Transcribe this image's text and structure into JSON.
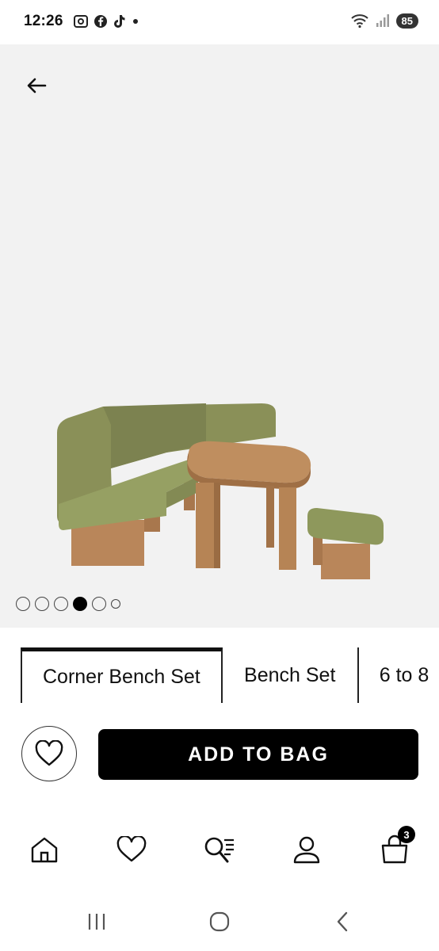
{
  "status_bar": {
    "time": "12:26",
    "battery": "85"
  },
  "gallery": {
    "image_alt": "Corner bench dining set",
    "total_slides": 6,
    "active_slide": 4
  },
  "variants": {
    "tabs": [
      "Corner Bench Set",
      "Bench Set",
      "6 to 8"
    ],
    "selected_index": 0
  },
  "actions": {
    "add_to_bag": "ADD TO BAG"
  },
  "bottom_nav": {
    "items": [
      "home-icon",
      "heart-icon",
      "search-list-icon",
      "account-icon",
      "bag-icon"
    ],
    "bag_count": "3"
  },
  "colors": {
    "accent": "#000000",
    "upholstery": "#8a9058",
    "wood": "#b9865a"
  }
}
